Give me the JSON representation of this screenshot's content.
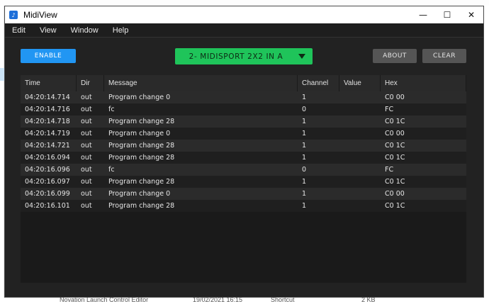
{
  "background": {
    "bottom_row": {
      "name": "Novation Launch Control Editor",
      "date": "19/02/2021 16:15",
      "type": "Shortcut",
      "size": "2 KB"
    }
  },
  "window": {
    "title": "MidiView",
    "icon": "midiview-app-icon",
    "controls": {
      "minimize": "—",
      "maximize": "☐",
      "close": "✕"
    }
  },
  "menu": [
    "Edit",
    "View",
    "Window",
    "Help"
  ],
  "toolbar": {
    "enable_label": "ENABLE",
    "device_label": "2- MIDISPORT 2X2 IN A",
    "about_label": "ABOUT",
    "clear_label": "CLEAR"
  },
  "colors": {
    "enable": "#2196f3",
    "device": "#1fc45a",
    "window_bg": "#222222"
  },
  "table": {
    "columns": [
      "Time",
      "Dir",
      "Message",
      "Channel",
      "Value",
      "Hex"
    ],
    "rows": [
      {
        "time": "04:20:14.714",
        "dir": "out",
        "message": "Program change 0",
        "channel": "1",
        "value": "",
        "hex": "C0 00"
      },
      {
        "time": "04:20:14.716",
        "dir": "out",
        "message": "fc",
        "channel": "0",
        "value": "",
        "hex": "FC"
      },
      {
        "time": "04:20:14.718",
        "dir": "out",
        "message": "Program change 28",
        "channel": "1",
        "value": "",
        "hex": "C0 1C"
      },
      {
        "time": "04:20:14.719",
        "dir": "out",
        "message": "Program change 0",
        "channel": "1",
        "value": "",
        "hex": "C0 00"
      },
      {
        "time": "04:20:14.721",
        "dir": "out",
        "message": "Program change 28",
        "channel": "1",
        "value": "",
        "hex": "C0 1C"
      },
      {
        "time": "04:20:16.094",
        "dir": "out",
        "message": "Program change 28",
        "channel": "1",
        "value": "",
        "hex": "C0 1C"
      },
      {
        "time": "04:20:16.096",
        "dir": "out",
        "message": "fc",
        "channel": "0",
        "value": "",
        "hex": "FC"
      },
      {
        "time": "04:20:16.097",
        "dir": "out",
        "message": "Program change 28",
        "channel": "1",
        "value": "",
        "hex": "C0 1C"
      },
      {
        "time": "04:20:16.099",
        "dir": "out",
        "message": "Program change 0",
        "channel": "1",
        "value": "",
        "hex": "C0 00"
      },
      {
        "time": "04:20:16.101",
        "dir": "out",
        "message": "Program change 28",
        "channel": "1",
        "value": "",
        "hex": "C0 1C"
      }
    ]
  }
}
